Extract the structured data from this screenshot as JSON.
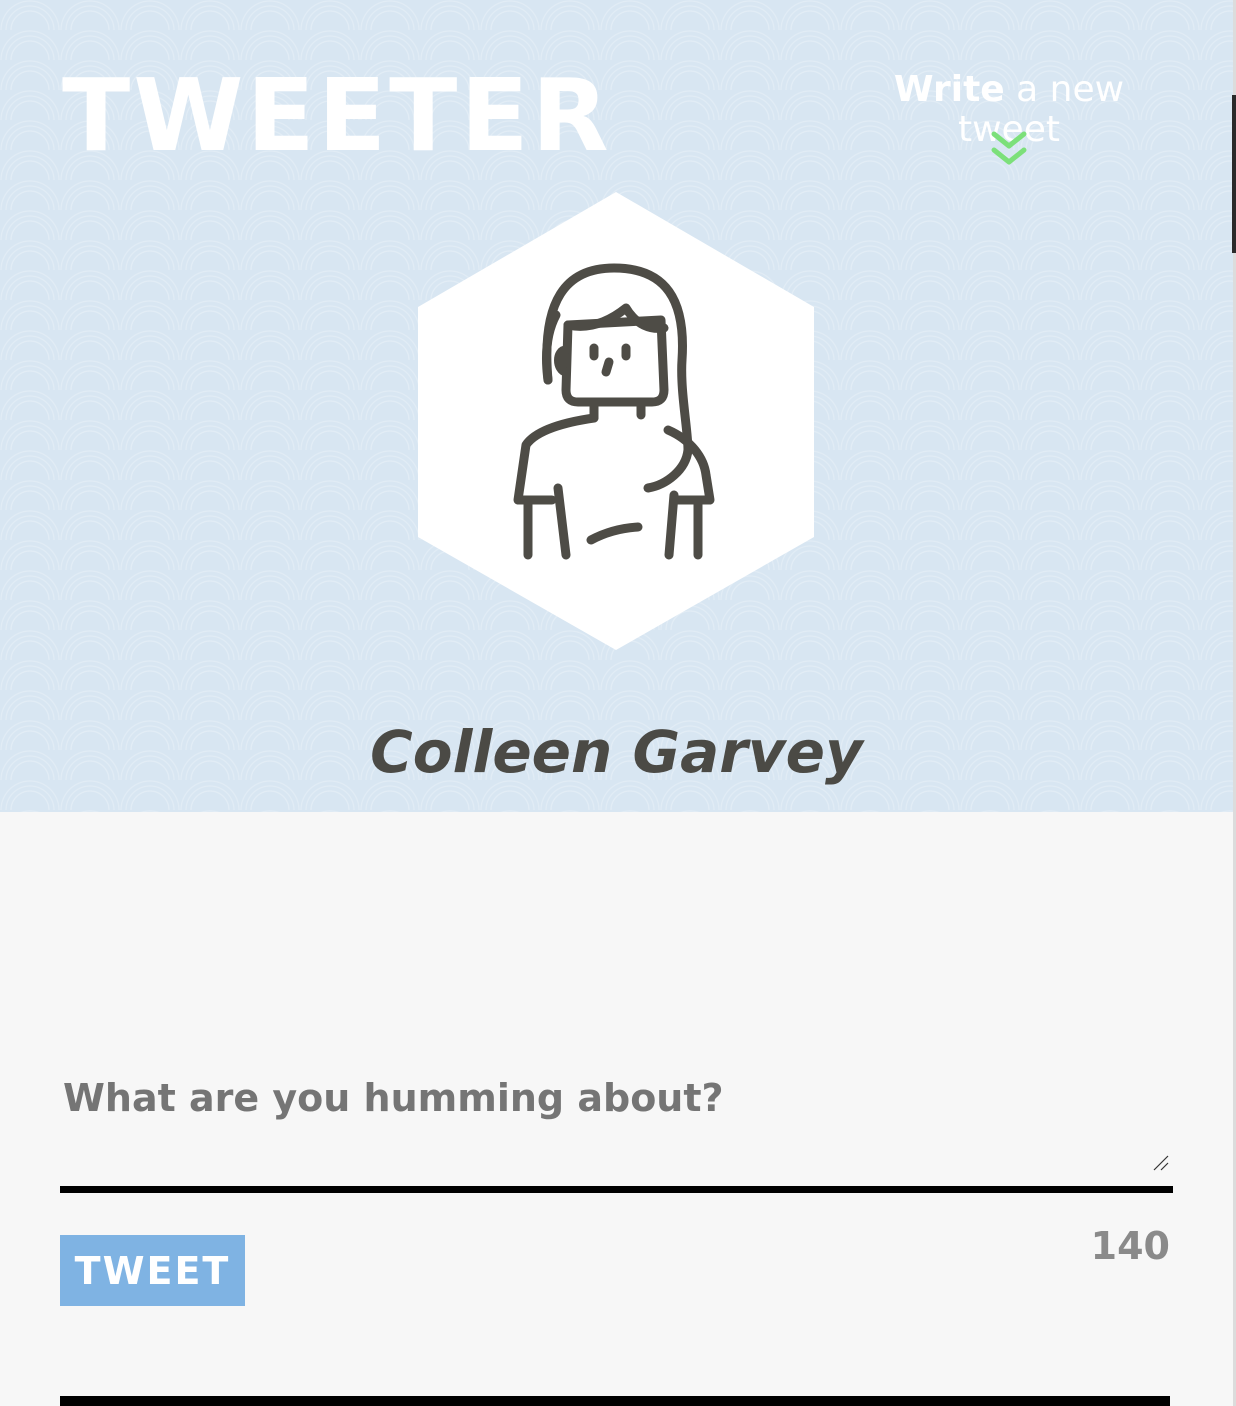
{
  "app": {
    "logo_text": "TWEETER"
  },
  "nav": {
    "compose_strong": "Write",
    "compose_light": " a new tweet",
    "toggle_icon": "double-chevron-down-icon",
    "toggle_color": "#7ce07a"
  },
  "profile": {
    "name": "Colleen Garvey",
    "avatar_icon": "woman-avatar-icon"
  },
  "compose": {
    "placeholder": "What are you humming about?",
    "value": "",
    "button_label": "TWEET",
    "counter": "140"
  },
  "colors": {
    "header_bg": "#d8e6f2",
    "button_bg": "#7fb3e3",
    "name_text": "#4b4a45"
  }
}
